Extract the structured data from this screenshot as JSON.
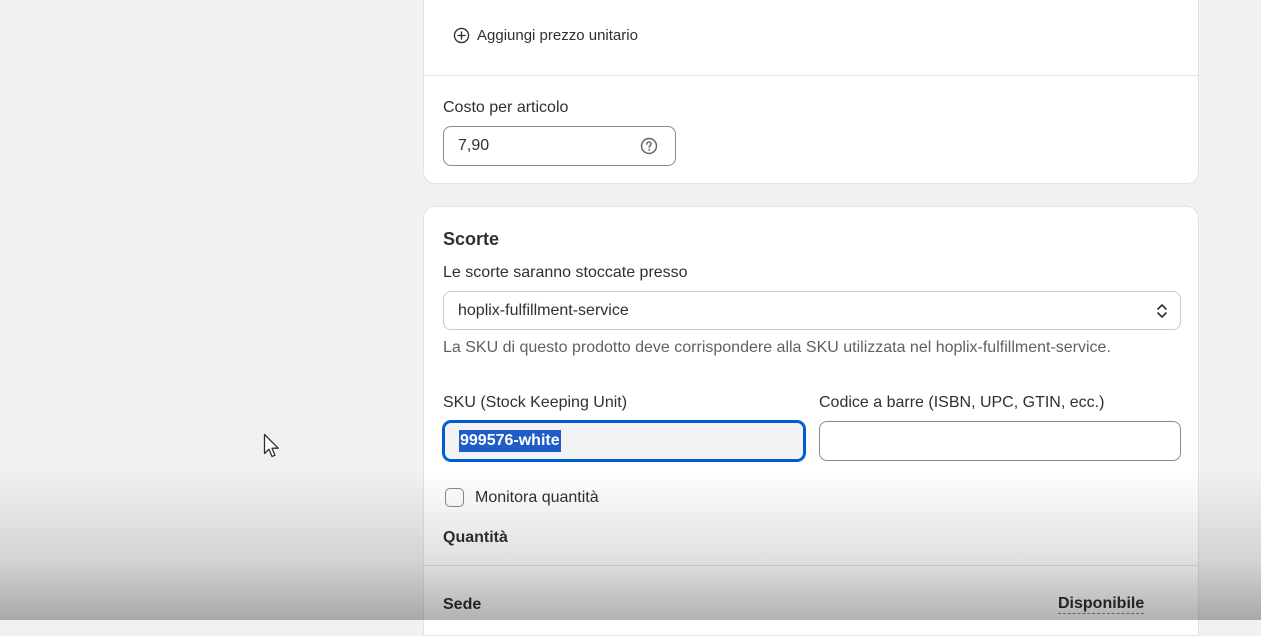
{
  "pricing": {
    "add_unit_price_label": "Aggiungi prezzo unitario",
    "cost_per_item_label": "Costo per articolo",
    "cost_per_item_value": "7,90"
  },
  "inventory": {
    "title": "Scorte",
    "stock_location_label": "Le scorte saranno stoccate presso",
    "stock_location_value": "hoplix-fulfillment-service",
    "sku_help_text": "La SKU di questo prodotto deve corrispondere alla SKU utilizzata nel hoplix-fulfillment-service.",
    "sku_label": "SKU (Stock Keeping Unit)",
    "sku_value": "999576-white",
    "barcode_label": "Codice a barre (ISBN, UPC, GTIN, ecc.)",
    "barcode_value": "",
    "track_quantity_label": "Monitora quantità",
    "track_quantity_checked": false,
    "quantity_heading": "Quantità",
    "table": {
      "col_location": "Sede",
      "col_available": "Disponibile"
    }
  },
  "colors": {
    "page_background": "#f1f1f1",
    "card_background": "#ffffff",
    "focus_ring": "#005bd3",
    "text_selection": "#1e5cc8"
  },
  "icons": {
    "add_unit_price": "plus-circle-icon",
    "cost_help": "question-circle-icon",
    "select_arrows": "chevron-up-down-icon",
    "cursor": "mouse-pointer-icon"
  }
}
